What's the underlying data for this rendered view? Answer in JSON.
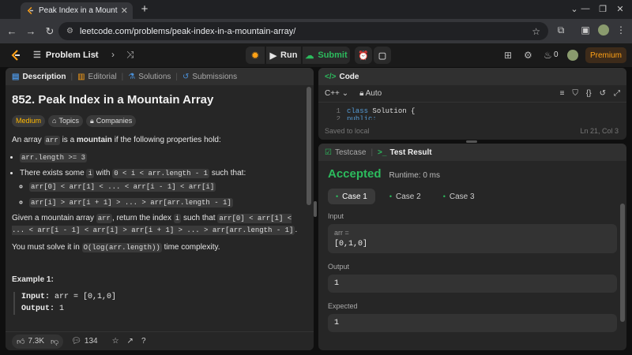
{
  "browser": {
    "tab_title": "Peak Index in a Mountain Arra",
    "url": "leetcode.com/problems/peak-index-in-a-mountain-array/",
    "new_tab_label": "+"
  },
  "toolbar": {
    "problem_list": "Problem List",
    "run": "Run",
    "submit": "Submit",
    "streak_count": "0",
    "premium": "Premium"
  },
  "description": {
    "tabs": [
      "Description",
      "Editorial",
      "Solutions",
      "Submissions"
    ],
    "title": "852. Peak Index in a Mountain Array",
    "difficulty": "Medium",
    "topics": "Topics",
    "companies": "Companies",
    "intro_pre": "An array",
    "intro_code": "arr",
    "intro_mid": "is a",
    "intro_bold": "mountain",
    "intro_post": "if the following properties hold:",
    "cond1_code": "arr.length >= 3",
    "cond2_pre": "There exists some",
    "cond2_code1": "i",
    "cond2_mid": "with",
    "cond2_code2": "0 < i < arr.length - 1",
    "cond2_post": "such that:",
    "sub1_code": "arr[0] < arr[1] < ... < arr[i - 1] < arr[i]",
    "sub2_code": "arr[i] > arr[i + 1] > ... > arr[arr.length - 1]",
    "given_pre": "Given a mountain array",
    "given_code1": "arr",
    "given_mid": ", return the index",
    "given_code2": "i",
    "given_mid2": "such that",
    "given_code3": "arr[0] < arr[1] < ... < arr[i - 1] < arr[i] > arr[i + 1] > ... > arr[arr.length - 1]",
    "given_post": ".",
    "solve_pre": "You must solve it in",
    "solve_code": "O(log(arr.length))",
    "solve_post": "time complexity.",
    "example_title": "Example 1:",
    "ex_input_label": "Input:",
    "ex_input_val": "arr = [0,1,0]",
    "ex_output_label": "Output:",
    "ex_output_val": "1",
    "likes": "7.3K",
    "comments": "134"
  },
  "code": {
    "header": "Code",
    "language": "C++",
    "auto": "Auto",
    "line1_no": "1",
    "line1_kw": "class",
    "line1_rest": "Solution {",
    "line2_no": "2",
    "line2": "public:",
    "saved": "Saved to local",
    "position": "Ln 21, Col 3"
  },
  "result": {
    "testcase_tab": "Testcase",
    "result_tab": "Test Result",
    "status": "Accepted",
    "runtime": "Runtime: 0 ms",
    "cases": [
      "Case 1",
      "Case 2",
      "Case 3"
    ],
    "input_label": "Input",
    "input_var": "arr =",
    "input_val": "[0,1,0]",
    "output_label": "Output",
    "output_val": "1",
    "expected_label": "Expected",
    "expected_val": "1"
  },
  "colors": {
    "accent": "#ffa116",
    "success": "#2cbb5d",
    "panel": "#262626",
    "background": "#0f0f0f"
  }
}
